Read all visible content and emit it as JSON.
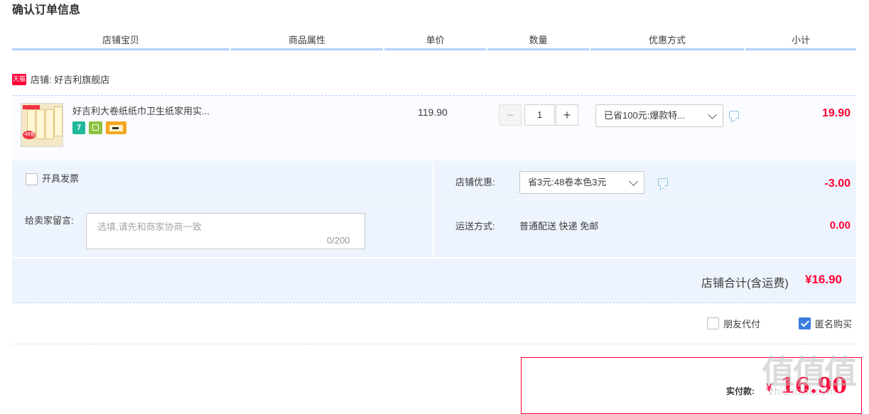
{
  "page_title": "确认订单信息",
  "columns": [
    "店铺宝贝",
    "商品属性",
    "单价",
    "数量",
    "优惠方式",
    "小计"
  ],
  "shop": {
    "badge": "天猫",
    "label": "店铺: 好吉利旗舰店"
  },
  "item": {
    "title": "好吉利大卷纸纸巾卫生纸家用实...",
    "thumb_badge": "48卷",
    "service_icons": [
      "7-day-return-icon",
      "guarantee-icon",
      "credit-card-icon"
    ],
    "service_seven": "7",
    "unit_price": "119.90",
    "quantity": "1",
    "minus": "−",
    "plus": "+",
    "discount_select": "已省100元:爆款特...",
    "subtotal": "19.90"
  },
  "invoice_label": "开具发票",
  "message": {
    "label": "给卖家留言:",
    "placeholder": "选填,请先和商家协商一致",
    "counter": "0/200"
  },
  "shop_discount": {
    "label": "店铺优惠:",
    "value": "省3元:48卷本色3元",
    "amount": "-3.00"
  },
  "shipping": {
    "label": "运送方式:",
    "value": "普通配送 快递 免邮",
    "amount": "0.00"
  },
  "shop_total": {
    "label": "店铺合计(含运费)",
    "value": "¥16.90"
  },
  "options": {
    "friend_pay": "朋友代付",
    "anonymous": "匿名购买",
    "anonymous_checked": true,
    "friend_checked": false
  },
  "payment": {
    "label": "实付款:",
    "currency": "¥",
    "value": "16.90"
  },
  "watermark": {
    "chars": "值值值",
    "url": "zhizhizhi.com"
  },
  "colors": {
    "accent_blue": "#b2d1ff",
    "price_red": "#ff0036",
    "panel_bg": "#eef4fd",
    "check_blue": "#3a7ce0"
  }
}
